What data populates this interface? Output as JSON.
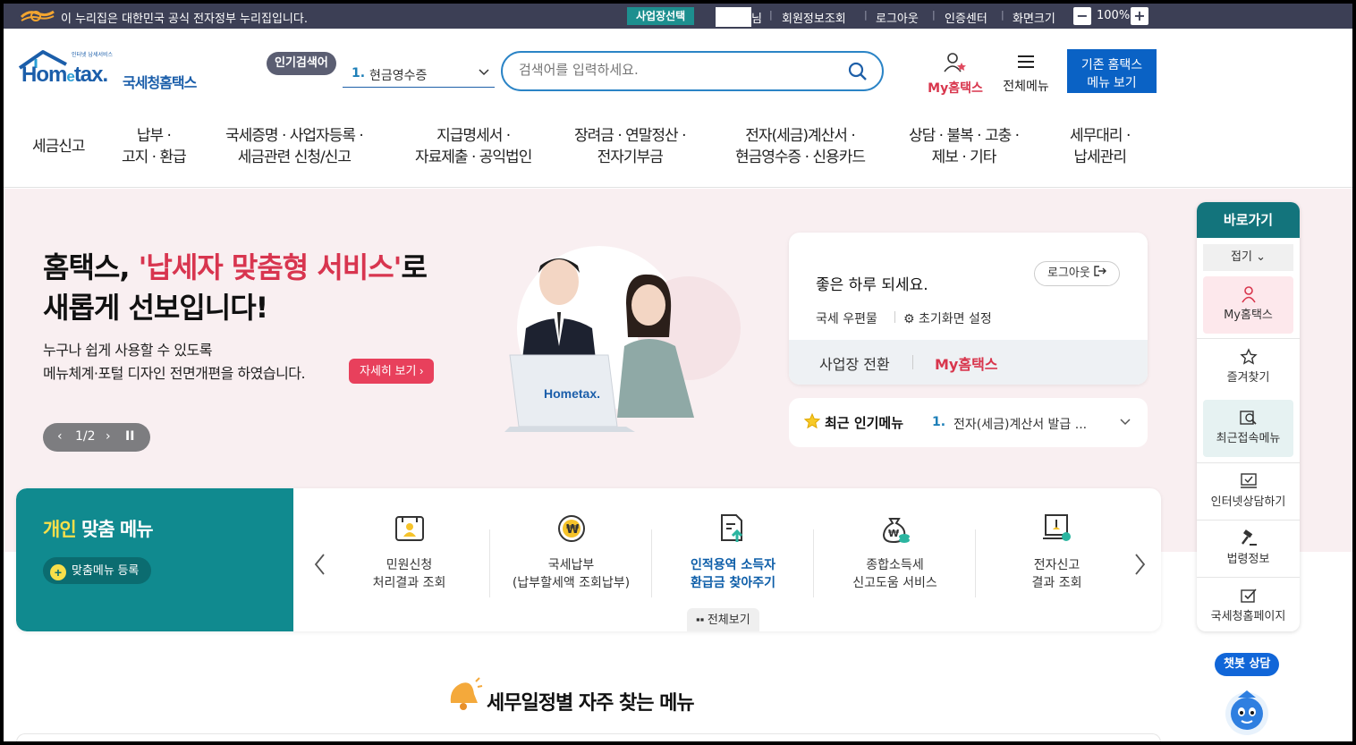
{
  "gov_bar": {
    "notice": "이 누리집은 대한민국 공식 전자정부 누리집입니다.",
    "business_select": "사업장선택",
    "user_suffix": "님",
    "links": [
      "회원정보조회",
      "로그아웃",
      "인증센터",
      "화면크기"
    ],
    "zoom_minus": "−",
    "zoom_level": "100%",
    "zoom_plus": "+"
  },
  "header": {
    "logo_small": "인터넷 납세서비스",
    "logo_text_1": "Hom",
    "logo_text_e": "e",
    "logo_text_2": "tax.",
    "logo_kr": "국세청홈택스",
    "popular_badge": "인기검색어",
    "popular_num": "1.",
    "popular_term": "현금영수증",
    "search_placeholder": "검색어를 입력하세요.",
    "my_hometax": "My홈택스",
    "all_menu": "전체메뉴",
    "old_hometax_line1": "기존 홈택스",
    "old_hometax_line2": "메뉴 보기"
  },
  "main_nav": [
    "세금신고",
    "납부 ·\n고지 · 환급",
    "국세증명 · 사업자등록 ·\n세금관련 신청/신고",
    "지급명세서 ·\n자료제출 · 공익법인",
    "장려금 · 연말정산 ·\n전자기부금",
    "전자(세금)계산서 ·\n현금영수증 · 신용카드",
    "상담 · 불복 · 고충 ·\n제보 · 기타",
    "세무대리 ·\n납세관리"
  ],
  "hero": {
    "title_a": "홈택스, ",
    "title_hl": "'납세자 맞춤형 서비스'",
    "title_b": "로",
    "title_line2": "새롭게 선보입니다!",
    "desc_line1": "누구나 쉽게 사용할 수 있도록",
    "desc_line2": "메뉴체계·포털 디자인 전면개편을 하였습니다.",
    "detail_button": "자세히 보기",
    "pager": "1/2",
    "laptop_logo": "Hometax."
  },
  "login_card": {
    "greeting": "좋은 하루 되세요.",
    "logout": "로그아웃",
    "mailbox": "국세 우편물",
    "init_setting": "초기화면 설정",
    "switch_business": "사업장 전환",
    "my_hometax": "My홈택스"
  },
  "recent_menu": {
    "title": "최근 인기메뉴",
    "num": "1.",
    "item": "전자(세금)계산서 발급 ..."
  },
  "quick_menu": {
    "title": "바로가기",
    "fold": "접기",
    "items": [
      "My홈택스",
      "즐겨찾기",
      "최근접속메뉴",
      "인터넷상담하기",
      "법령정보",
      "국세청홈페이지"
    ]
  },
  "custom_menu": {
    "title_y": "개인",
    "title_w": " 맞춤 메뉴",
    "register": "맞춤메뉴 등록",
    "items": [
      {
        "line1": "민원신청",
        "line2": "처리결과 조회",
        "icon": "document-person-icon"
      },
      {
        "line1": "국세납부",
        "line2": "(납부할세액 조회납부)",
        "icon": "won-coin-icon"
      },
      {
        "line1": "인적용역 소득자",
        "line2": "환급금 찾아주기",
        "icon": "document-upload-icon"
      },
      {
        "line1": "종합소득세",
        "line2": "신고도움 서비스",
        "icon": "money-bag-icon"
      },
      {
        "line1": "전자신고",
        "line2": "결과 조회",
        "icon": "monitor-check-icon"
      }
    ],
    "all_view": "전체보기"
  },
  "schedule": {
    "title": "세무일정별 자주 찾는 메뉴"
  },
  "chatbot": {
    "label": "챗봇 상담"
  },
  "colors": {
    "gov_bar": "#3c3f55",
    "brand_blue": "#0a62c5",
    "accent_red": "#d8364d",
    "teal": "#108a8f",
    "hero_bg": "#f9eff1"
  }
}
